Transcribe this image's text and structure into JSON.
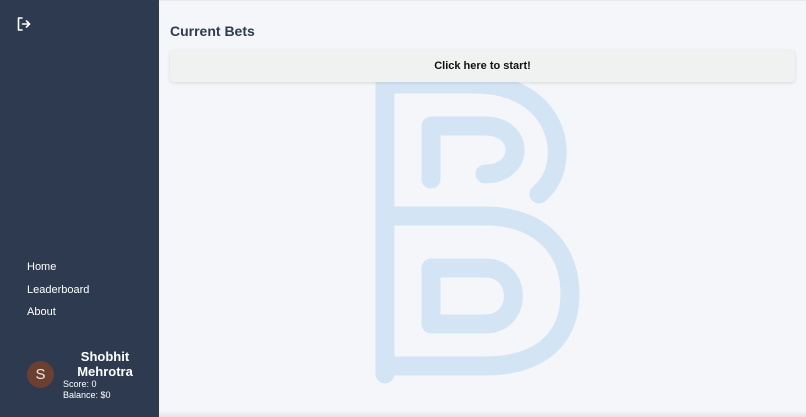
{
  "sidebar": {
    "logout_icon": "logout-icon",
    "nav": {
      "home_label": "Home",
      "leaderboard_label": "Leaderboard",
      "about_label": "About"
    },
    "user": {
      "avatar_initial": "S",
      "name_line1": "Shobhit",
      "name_line2": "Mehrotra",
      "score": "Score: 0",
      "balance": "Balance: $0"
    }
  },
  "main": {
    "title": "Current Bets",
    "start_button_label": "Click here to start!",
    "watermark_icon": "b-logo-watermark"
  },
  "colors": {
    "sidebar_bg": "#2d3a50",
    "main_bg": "#f4f6fa",
    "watermark": "#d3e5f4",
    "avatar_bg": "#6b3f31"
  }
}
